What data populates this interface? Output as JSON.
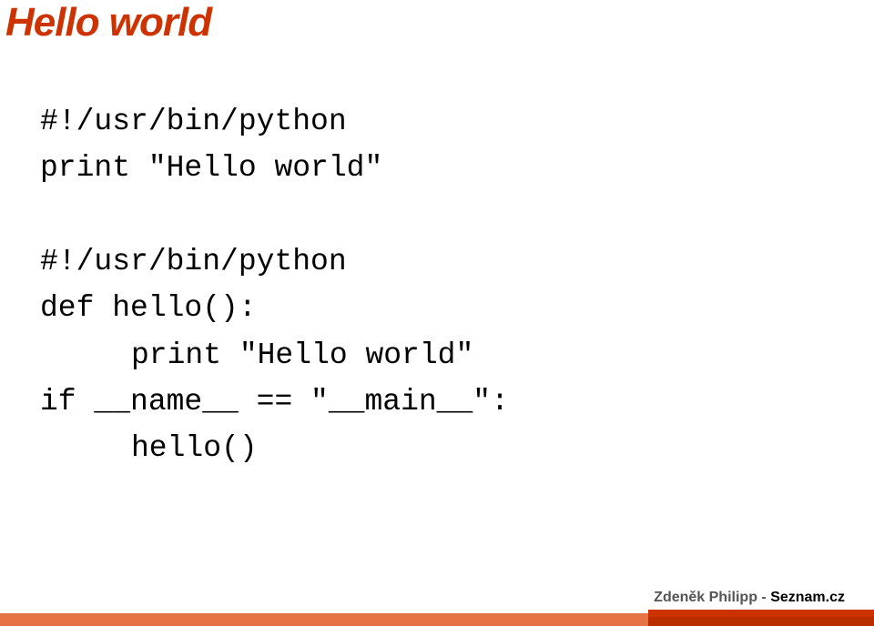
{
  "title": "Hello world",
  "code1": {
    "line1": "#!/usr/bin/python",
    "line2": "print \"Hello world\""
  },
  "code2": {
    "line1": "#!/usr/bin/python",
    "line2": "def hello():",
    "line3": "print \"Hello world\"",
    "line4": "if __name__ == \"__main__\":",
    "line5": "hello()"
  },
  "footer": {
    "name": "Zdeněk Philipp - ",
    "site": "Seznam.cz"
  }
}
